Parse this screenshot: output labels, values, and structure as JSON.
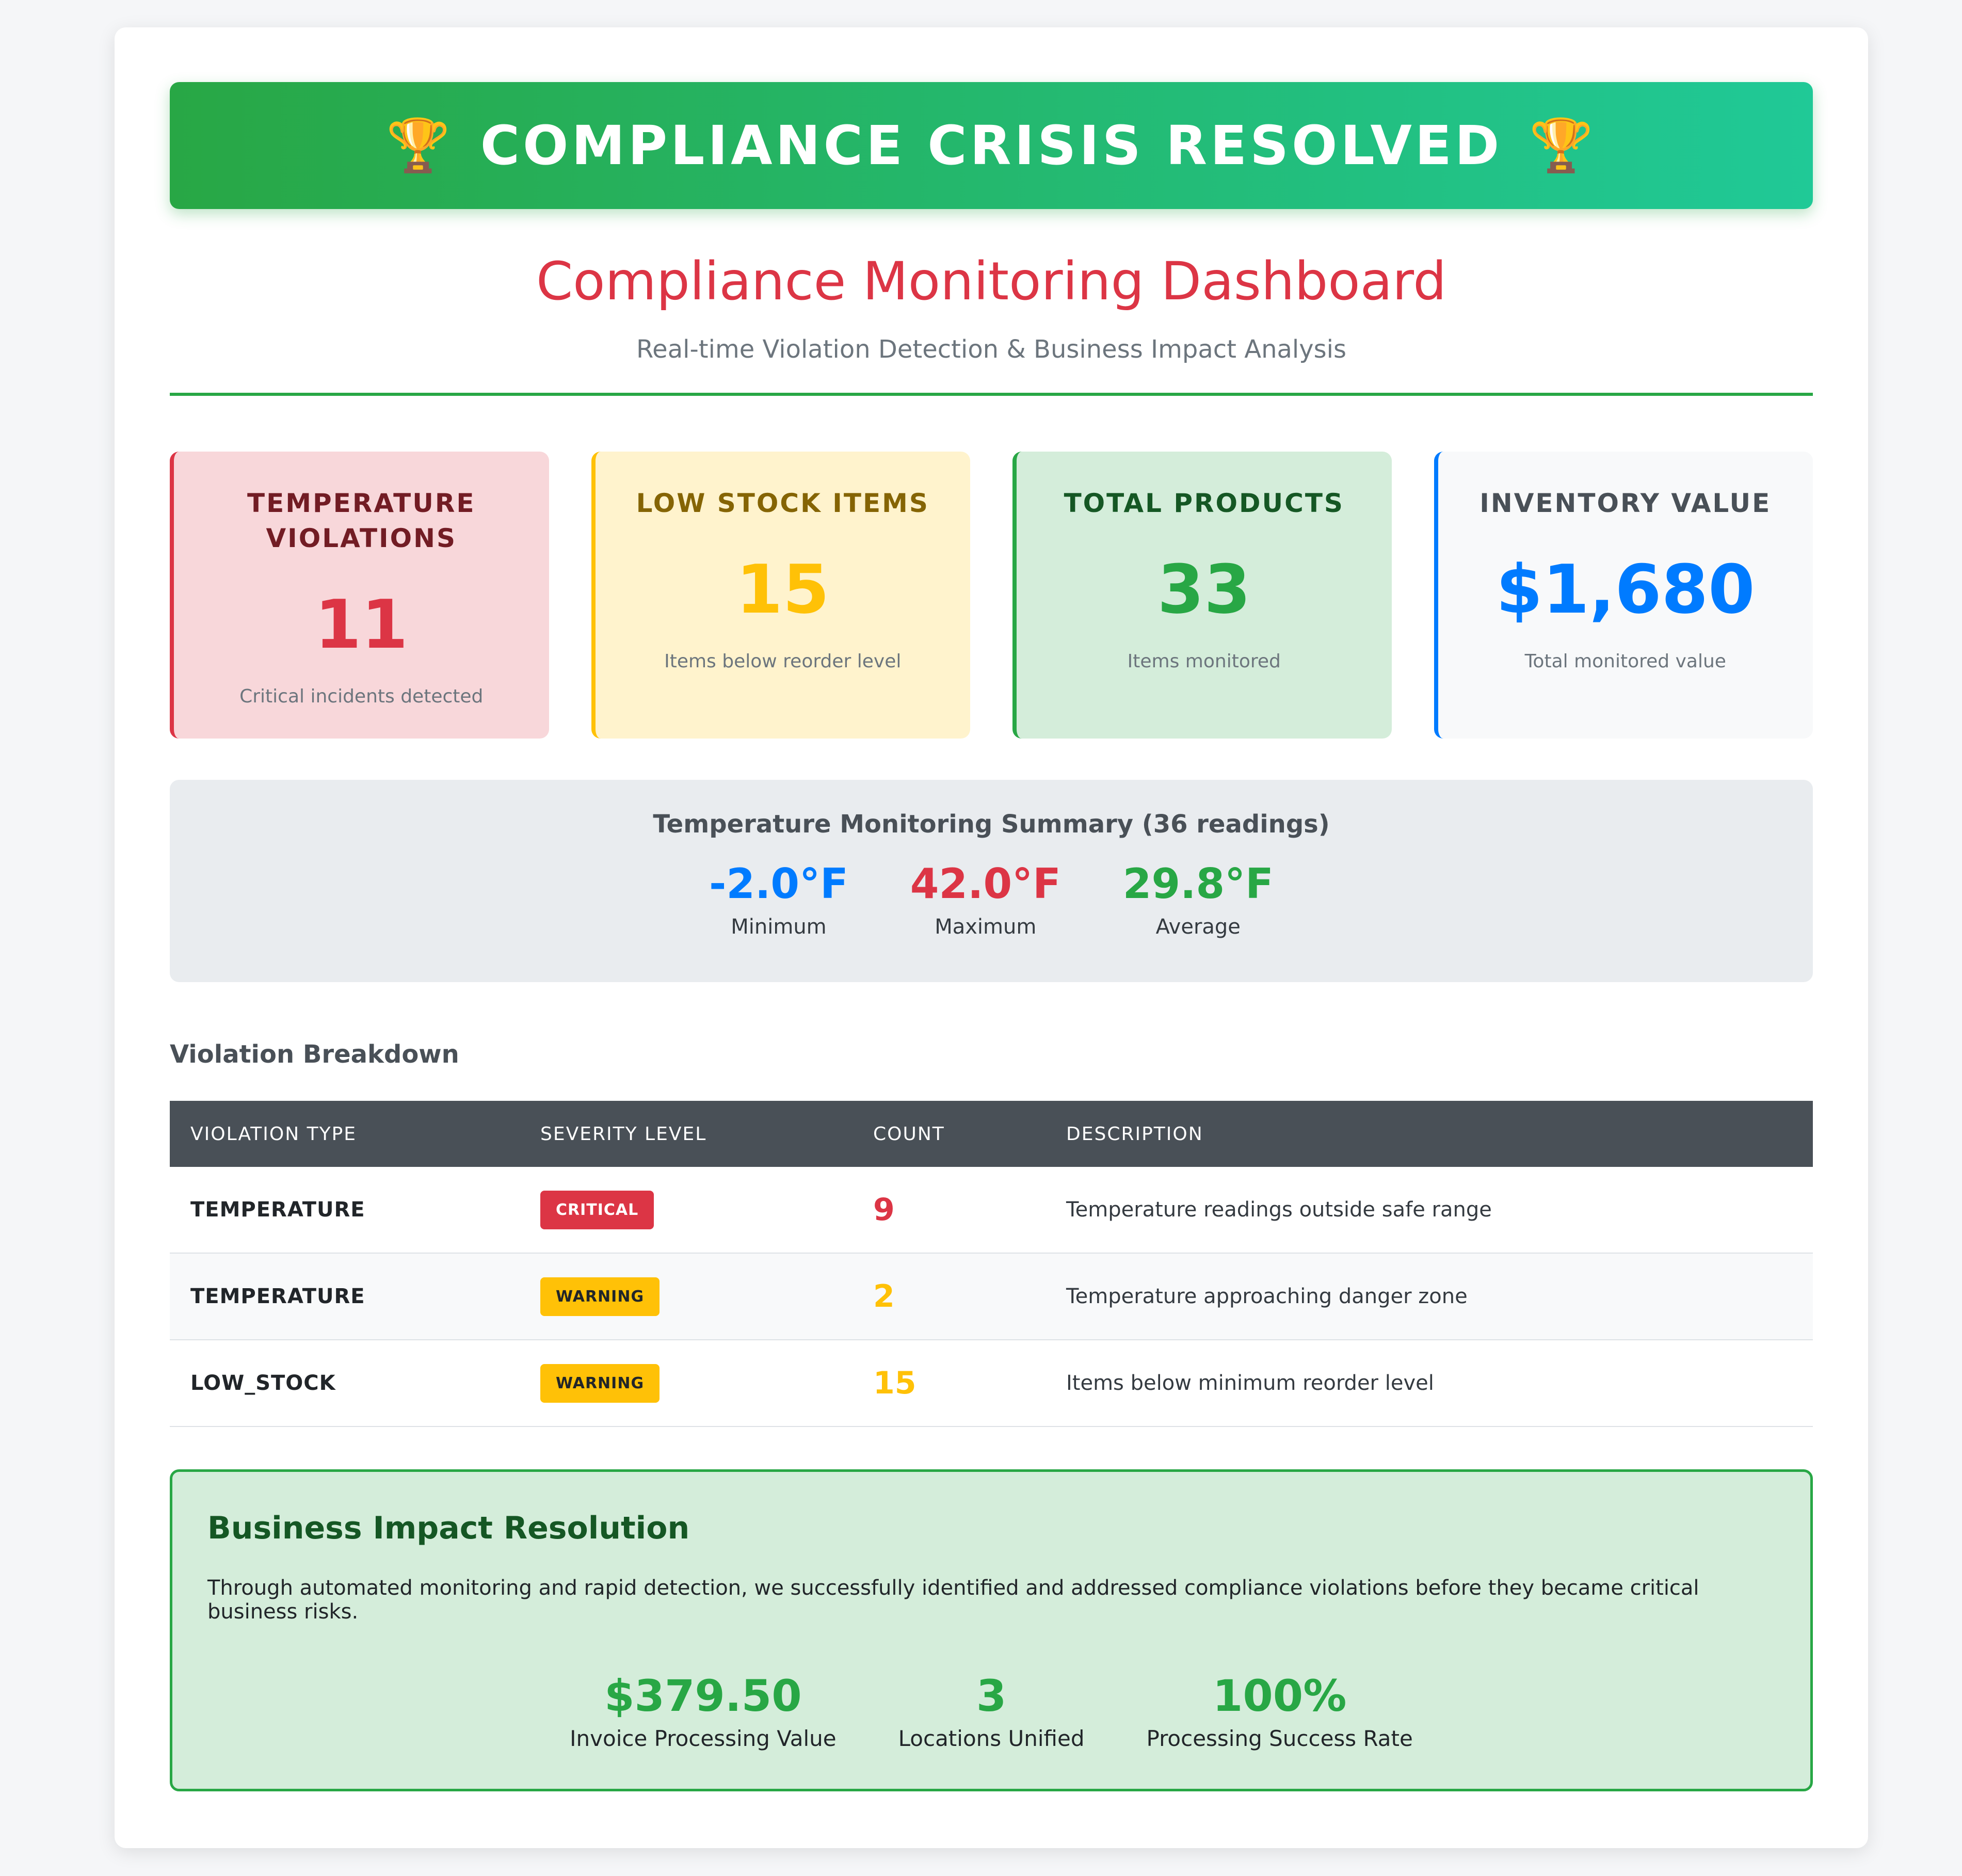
{
  "banner": {
    "icon_left": "🏆",
    "text": "COMPLIANCE CRISIS RESOLVED",
    "icon_right": "🏆"
  },
  "header": {
    "title": "Compliance Monitoring Dashboard",
    "subtitle": "Real-time Violation Detection & Business Impact Analysis"
  },
  "stats": [
    {
      "label": "TEMPERATURE VIOLATIONS",
      "value": "11",
      "desc": "Critical incidents detected",
      "color": "#dc3545"
    },
    {
      "label": "LOW STOCK ITEMS",
      "value": "15",
      "desc": "Items below reorder level",
      "color": "#ffc107"
    },
    {
      "label": "TOTAL PRODUCTS",
      "value": "33",
      "desc": "Items monitored",
      "color": "#28a745"
    },
    {
      "label": "INVENTORY VALUE",
      "value": "$1,680",
      "desc": "Total monitored value",
      "color": "#007bff"
    }
  ],
  "temperature_summary": {
    "title": "Temperature Monitoring Summary (36 readings)",
    "items": [
      {
        "value": "-2.0°F",
        "label": "Minimum",
        "color": "#007bff"
      },
      {
        "value": "42.0°F",
        "label": "Maximum",
        "color": "#dc3545"
      },
      {
        "value": "29.8°F",
        "label": "Average",
        "color": "#28a745"
      }
    ]
  },
  "violations": {
    "title": "Violation Breakdown",
    "columns": [
      "VIOLATION TYPE",
      "SEVERITY LEVEL",
      "COUNT",
      "DESCRIPTION"
    ],
    "rows": [
      {
        "type": "TEMPERATURE",
        "severity": "CRITICAL",
        "count": "9",
        "description": "Temperature readings outside safe range"
      },
      {
        "type": "TEMPERATURE",
        "severity": "WARNING",
        "count": "2",
        "description": "Temperature approaching danger zone"
      },
      {
        "type": "LOW_STOCK",
        "severity": "WARNING",
        "count": "15",
        "description": "Items below minimum reorder level"
      }
    ]
  },
  "impact": {
    "title": "Business Impact Resolution",
    "text": "Through automated monitoring and rapid detection, we successfully identified and addressed compliance violations before they became critical business risks.",
    "metrics": [
      {
        "value": "$379.50",
        "label": "Invoice Processing Value"
      },
      {
        "value": "3",
        "label": "Locations Unified"
      },
      {
        "value": "100%",
        "label": "Processing Success Rate"
      }
    ]
  },
  "colors": {
    "success": "#28a745",
    "danger": "#dc3545",
    "warning": "#ffc107",
    "primary": "#007bff",
    "dark": "#495057"
  }
}
